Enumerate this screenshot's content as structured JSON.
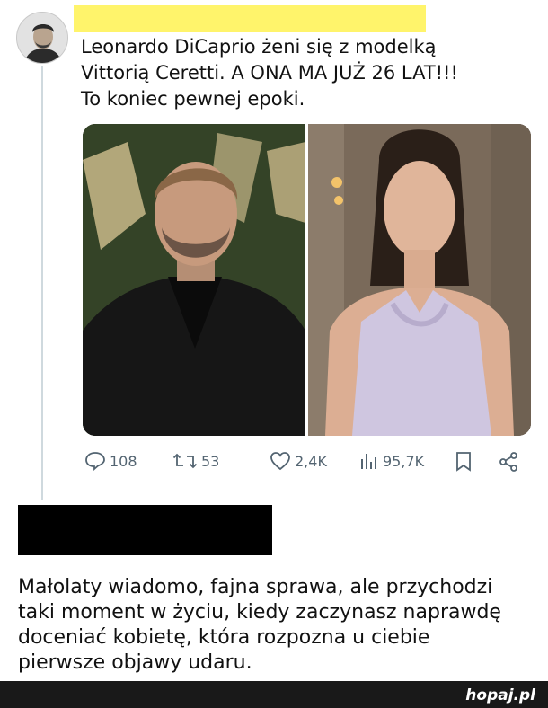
{
  "tweet": {
    "lines": [
      "Leonardo DiCaprio żeni się z modelką",
      "Vittorią Ceretti. A ONA MA JUŻ 26 LAT!!!",
      "To koniec pewnej epoki."
    ]
  },
  "metrics": {
    "replies": "108",
    "retweets": "53",
    "likes": "2,4K",
    "views": "95,7K"
  },
  "comment": {
    "lines": [
      "Małolaty wiadomo, fajna sprawa, ale przychodzi",
      "taki moment w życiu, kiedy zaczynasz naprawdę",
      "doceniać kobietę, która rozpozna u ciebie",
      "pierwsze objawy udaru."
    ]
  },
  "footer": {
    "brand": "hopaj.pl"
  },
  "colors": {
    "icon_gray": "#536471",
    "highlight": "#fff46b",
    "footer_bg": "#191919"
  }
}
